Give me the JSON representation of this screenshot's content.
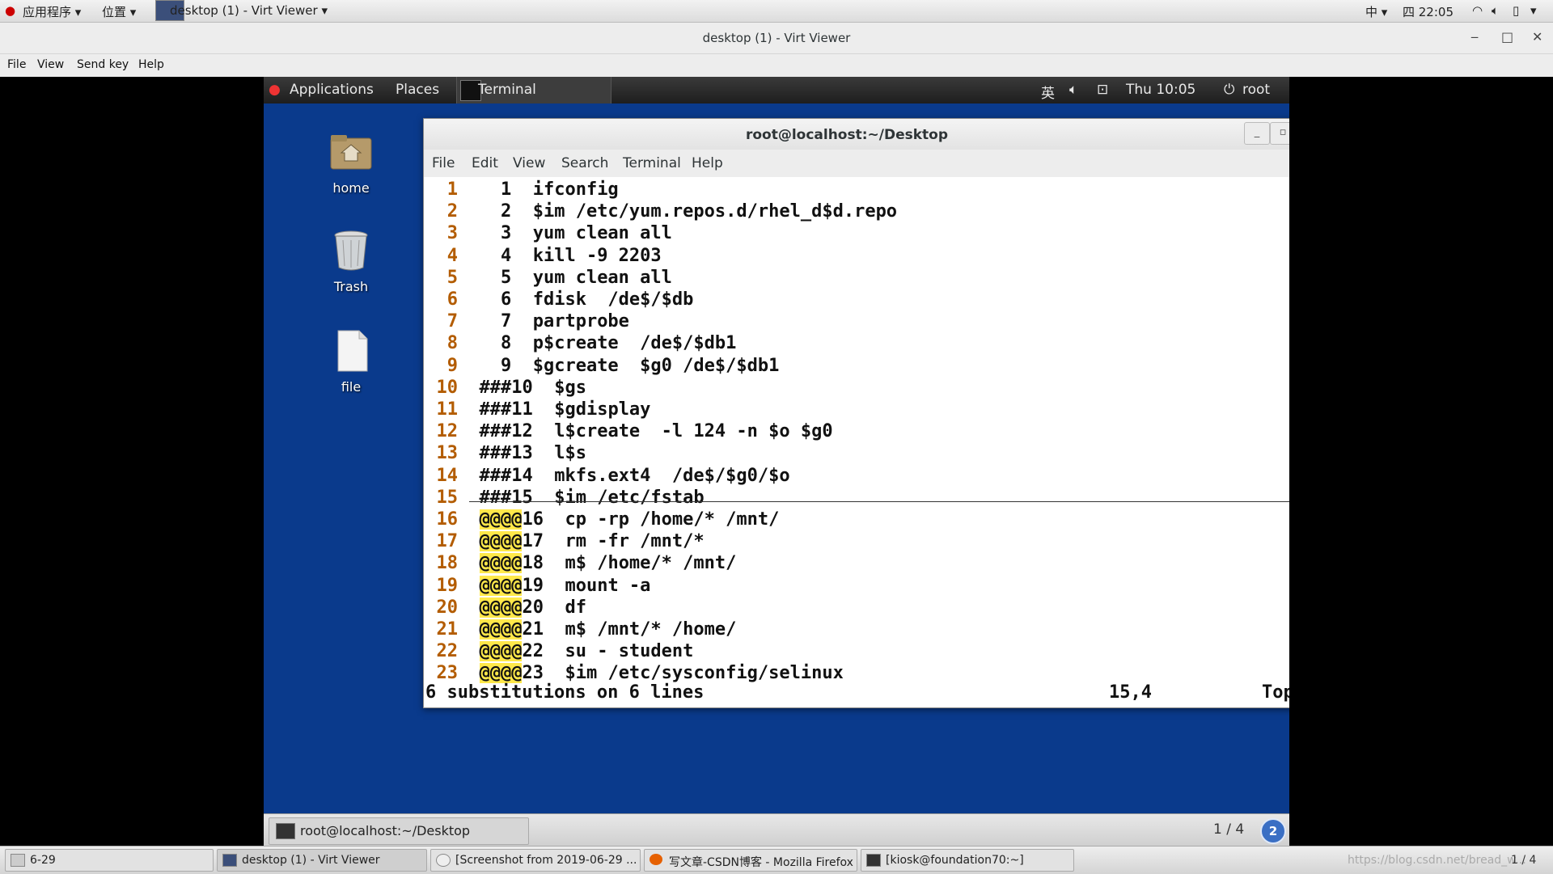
{
  "host_panel": {
    "apps_menu": "应用程序",
    "places_menu": "位置",
    "active_window": "desktop (1) - Virt Viewer",
    "input_method": "中",
    "clock": "四 22:05",
    "page_indicator": "1 / 4"
  },
  "virt_viewer": {
    "title": "desktop (1) - Virt Viewer",
    "menu": [
      "File",
      "View",
      "Send key",
      "Help"
    ]
  },
  "guest_panel": {
    "applications": "Applications",
    "places": "Places",
    "terminal_tab": "Terminal",
    "input_method": "英",
    "clock": "Thu 10:05",
    "user": "root"
  },
  "desktop_icons": [
    {
      "label": "home"
    },
    {
      "label": "Trash"
    },
    {
      "label": "file"
    }
  ],
  "terminal": {
    "title": "root@localhost:~/Desktop",
    "menu": [
      "File",
      "Edit",
      "View",
      "Search",
      "Terminal",
      "Help"
    ],
    "lines": [
      {
        "num": "1",
        "pre": "    1  ",
        "hl": "",
        "text": "ifconfig"
      },
      {
        "num": "2",
        "pre": "    2  ",
        "hl": "",
        "text": "$im /etc/yum.repos.d/rhel_d$d.repo"
      },
      {
        "num": "3",
        "pre": "    3  ",
        "hl": "",
        "text": "yum clean all"
      },
      {
        "num": "4",
        "pre": "    4  ",
        "hl": "",
        "text": "kill -9 2203"
      },
      {
        "num": "5",
        "pre": "    5  ",
        "hl": "",
        "text": "yum clean all"
      },
      {
        "num": "6",
        "pre": "    6  ",
        "hl": "",
        "text": "fdisk  /de$/$db"
      },
      {
        "num": "7",
        "pre": "    7  ",
        "hl": "",
        "text": "partprobe"
      },
      {
        "num": "8",
        "pre": "    8  ",
        "hl": "",
        "text": "p$create  /de$/$db1"
      },
      {
        "num": "9",
        "pre": "    9  ",
        "hl": "",
        "text": "$gcreate  $g0 /de$/$db1"
      },
      {
        "num": "10",
        "pre": "  ###10  ",
        "hl": "",
        "text": "$gs"
      },
      {
        "num": "11",
        "pre": "  ###11  ",
        "hl": "",
        "text": "$gdisplay"
      },
      {
        "num": "12",
        "pre": "  ###12  ",
        "hl": "",
        "text": "l$create  -l 124 -n $o $g0"
      },
      {
        "num": "13",
        "pre": "  ###13  ",
        "hl": "",
        "text": "l$s"
      },
      {
        "num": "14",
        "pre": "  ###14  ",
        "hl": "",
        "text": "mkfs.ext4  /de$/$g0/$o"
      },
      {
        "num": "15",
        "pre": "  ###15  ",
        "hl": "",
        "text": "$im /etc/fstab"
      },
      {
        "num": "16",
        "pre": "  ",
        "hl": "@@@@",
        "text": "16  cp -rp /home/* /mnt/"
      },
      {
        "num": "17",
        "pre": "  ",
        "hl": "@@@@",
        "text": "17  rm -fr /mnt/*"
      },
      {
        "num": "18",
        "pre": "  ",
        "hl": "@@@@",
        "text": "18  m$ /home/* /mnt/"
      },
      {
        "num": "19",
        "pre": "  ",
        "hl": "@@@@",
        "text": "19  mount -a"
      },
      {
        "num": "20",
        "pre": "  ",
        "hl": "@@@@",
        "text": "20  df"
      },
      {
        "num": "21",
        "pre": "  ",
        "hl": "@@@@",
        "text": "21  m$ /mnt/* /home/"
      },
      {
        "num": "22",
        "pre": "  ",
        "hl": "@@@@",
        "text": "22  su - student"
      },
      {
        "num": "23",
        "pre": "  ",
        "hl": "@@@@",
        "text": "23  $im /etc/sysconfig/selinux"
      }
    ],
    "status_message": "6 substitutions on 6 lines",
    "cursor_pos": "15,4",
    "scroll_pos": "Top"
  },
  "guest_bottom": {
    "task_label": "root@localhost:~/Desktop",
    "workspace": "1 / 4",
    "help_badge": "2"
  },
  "host_taskbar": {
    "items": [
      {
        "label": "6-29"
      },
      {
        "label": "desktop (1) - Virt Viewer"
      },
      {
        "label": "[Screenshot from 2019-06-29 ..."
      },
      {
        "label": "写文章-CSDN博客 - Mozilla Firefox"
      },
      {
        "label": "[kiosk@foundation70:~]"
      }
    ],
    "watermark": "https://blog.csdn.net/bread_w..."
  }
}
